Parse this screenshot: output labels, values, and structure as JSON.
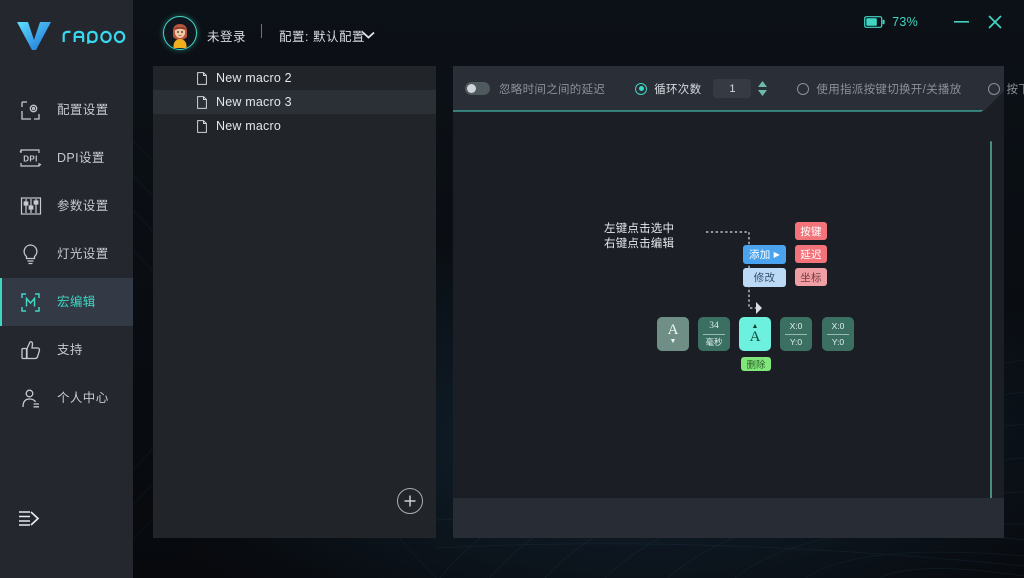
{
  "brand": {
    "name": "rapoo",
    "logo_icon": "rapoo-v-logo"
  },
  "sidebar": {
    "items": [
      {
        "label": "配置设置",
        "icon": "profile-settings-icon",
        "active": false
      },
      {
        "label": "DPI设置",
        "icon": "dpi-icon",
        "active": false
      },
      {
        "label": "参数设置",
        "icon": "sliders-icon",
        "active": false
      },
      {
        "label": "灯光设置",
        "icon": "bulb-icon",
        "active": false
      },
      {
        "label": "宏编辑",
        "icon": "macro-m-icon",
        "active": true
      },
      {
        "label": "支持",
        "icon": "thumbs-up-icon",
        "active": false
      },
      {
        "label": "个人中心",
        "icon": "user-icon",
        "active": false
      }
    ],
    "collapse_icon": "collapse-menu-icon"
  },
  "header": {
    "avatar_icon": "user-avatar",
    "login_status": "未登录",
    "divider": "|",
    "profile_label": "配置: 默认配置",
    "caret_icon": "chevron-down-icon",
    "battery_icon": "battery-icon",
    "battery_percent": "73%",
    "minimize_icon": "minimize-icon",
    "close_icon": "close-icon"
  },
  "macro_list": {
    "items": [
      {
        "name": "New macro 2",
        "icon": "file-icon"
      },
      {
        "name": "New macro 3",
        "icon": "file-icon"
      },
      {
        "name": "New macro",
        "icon": "file-icon"
      }
    ],
    "add_button_icon": "plus-circle-icon",
    "scrollbar": "list-scrollbar"
  },
  "toolbar": {
    "ignore_delay_label": "忽略时间之间的延迟",
    "ignore_delay_toggle": "off",
    "loop_count_label": "循环次数",
    "loop_count_selected": true,
    "loop_count_value": "1",
    "spinner_icon": "spinner-up-down-icon",
    "toggle_play_label": "使用指派按键切换开/关播放",
    "toggle_play_selected": false,
    "press_play_label": "按下时播放",
    "press_play_selected": false
  },
  "editor": {
    "hint_line1": "左键点击选中",
    "hint_line2": "右键点击编辑",
    "context_menu": [
      {
        "label": "添加",
        "has_arrow": true,
        "style": "blue"
      },
      {
        "label": "修改",
        "has_arrow": false,
        "style": "blue-light"
      }
    ],
    "submenu": [
      {
        "label": "按键",
        "style": "red"
      },
      {
        "label": "延迟",
        "style": "red"
      },
      {
        "label": "坐标",
        "style": "red-light"
      }
    ],
    "cells": [
      {
        "type": "key",
        "main": "A",
        "caret": "down",
        "selected": false
      },
      {
        "type": "delay",
        "value": "34",
        "unit": "毫秒",
        "selected": false
      },
      {
        "type": "key",
        "main": "A",
        "caret": "up",
        "selected": true
      },
      {
        "type": "coord",
        "x": "X:0",
        "y": "Y:0",
        "selected": false
      },
      {
        "type": "coord",
        "x": "X:0",
        "y": "Y:0",
        "selected": false
      }
    ],
    "delete_label": "删除",
    "scrollbar": "editor-scrollbar"
  },
  "colors": {
    "accent": "#3fd6c4",
    "sidebar_bg": "#24272d",
    "panel_bg": "#212429",
    "editor_bg": "#1b1e24",
    "selected_key": "#6ef0de",
    "delete_green": "#80e87a"
  }
}
